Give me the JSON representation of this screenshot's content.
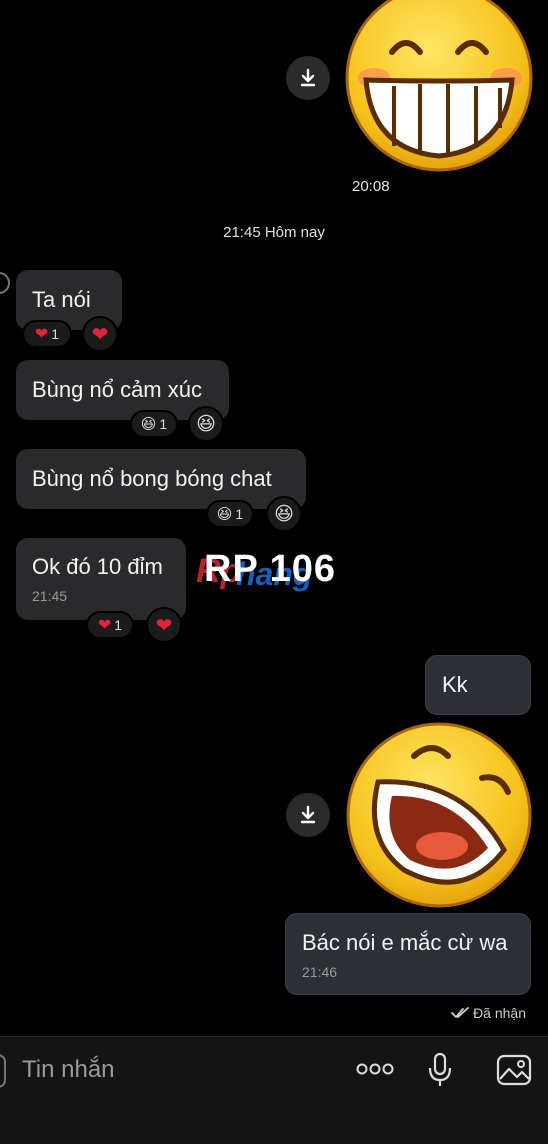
{
  "messages": {
    "sticker1_time": "20:08",
    "date_separator": "21:45 Hôm nay",
    "in": [
      {
        "text": "Ta nói",
        "reaction_count": "1"
      },
      {
        "text": "Bùng nổ cảm xúc",
        "reaction_count": "1"
      },
      {
        "text": "Bùng nổ bong bóng chat",
        "reaction_count": "1"
      },
      {
        "text": "Ok đó 10 đỉm",
        "time": "21:45",
        "reaction_count": "1"
      }
    ],
    "out": [
      {
        "text": "Kk"
      },
      {
        "text": "Bác nói e mắc cừ wa",
        "time": "21:46"
      }
    ],
    "status": "Đã nhận"
  },
  "watermark": "RP 106",
  "composer": {
    "placeholder": "Tin nhắn"
  },
  "icons": [
    "download-icon",
    "heart-icon",
    "laugh-emoji-icon",
    "more-icon",
    "microphone-icon",
    "image-icon",
    "double-check-icon"
  ],
  "colors": {
    "background": "#000000",
    "bubble_in": "#2a2a2c",
    "bubble_out": "#2c2f36",
    "heart": "#e0243c"
  }
}
